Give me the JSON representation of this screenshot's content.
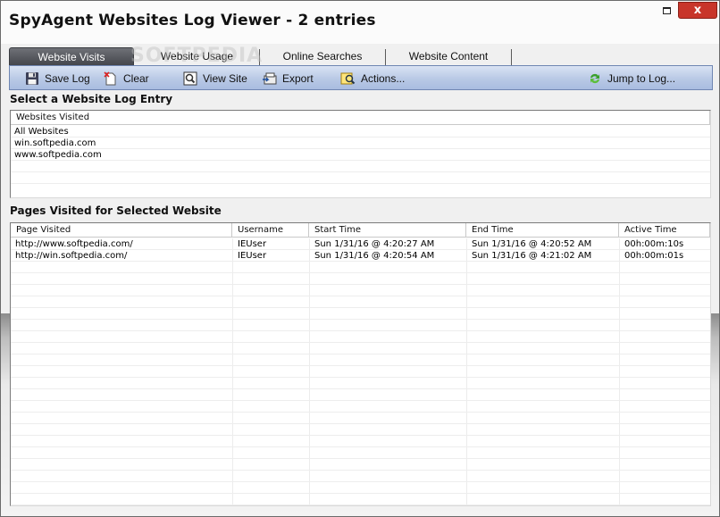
{
  "window": {
    "title": "SpyAgent Websites Log Viewer - 2 entries",
    "close_glyph": "x",
    "minimize_icon": "minimize-icon"
  },
  "tabs": [
    {
      "label": "Website Visits",
      "active": true
    },
    {
      "label": "Website Usage",
      "active": false
    },
    {
      "label": "Online Searches",
      "active": false
    },
    {
      "label": "Website Content",
      "active": false
    }
  ],
  "watermark": "SOFTPEDIA",
  "toolbar": {
    "save_log": "Save Log",
    "clear": "Clear",
    "view_site": "View Site",
    "export": "Export",
    "actions": "Actions...",
    "jump_to_log": "Jump to Log..."
  },
  "sites_section": {
    "label": "Select a Website Log Entry",
    "column": "Websites Visited",
    "items": [
      "All Websites",
      "win.softpedia.com",
      "www.softpedia.com"
    ]
  },
  "pages_section": {
    "label": "Pages Visited for Selected Website",
    "columns": [
      "Page Visited",
      "Username",
      "Start Time",
      "End Time",
      "Active Time"
    ],
    "rows": [
      [
        "http://www.softpedia.com/",
        "IEUser",
        "Sun  1/31/16 @ 4:20:27 AM",
        "Sun  1/31/16 @ 4:20:52 AM",
        "00h:00m:10s"
      ],
      [
        "http://win.softpedia.com/",
        "IEUser",
        "Sun  1/31/16 @ 4:20:54 AM",
        "Sun  1/31/16 @ 4:21:02 AM",
        "00h:00m:01s"
      ]
    ]
  },
  "colors": {
    "toolbar_top": "#d9e3f4",
    "toolbar_bottom": "#a9bce0",
    "tab_active": "#55575c",
    "close_button": "#c8352a"
  }
}
